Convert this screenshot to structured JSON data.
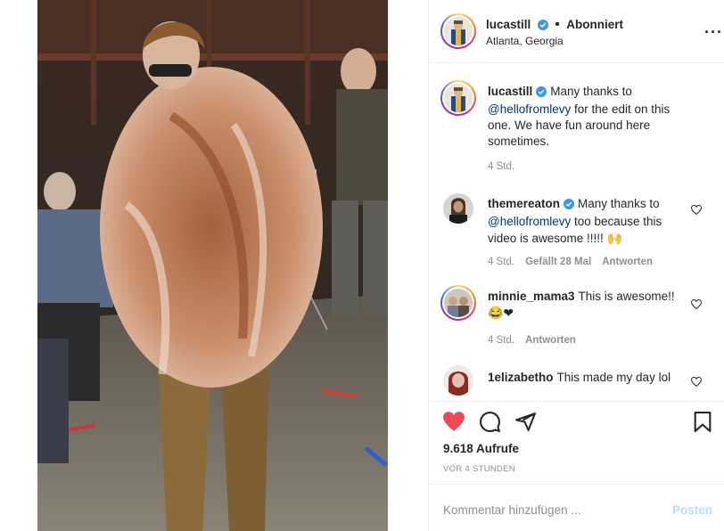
{
  "header": {
    "username": "lucastill",
    "follow_status": "Abonniert",
    "location": "Atlanta, Georgia",
    "more_icon": "ellipsis-icon"
  },
  "comments": [
    {
      "username": "lucastill",
      "text_before": "Many thanks to ",
      "mention": "@hellofromlevy",
      "text_after": " for the edit on this one. We have fun around here sometimes.",
      "emoji": "",
      "time": "4 Std.",
      "likes": "",
      "reply": "",
      "verified": true
    },
    {
      "username": "themereaton",
      "text_before": "Many thanks to ",
      "mention": "@hellofromlevy",
      "text_after": " too because this video is awesome !!!!! ",
      "emoji": "🙌",
      "time": "4 Std.",
      "likes": "Gefällt 28 Mal",
      "reply": "Antworten",
      "verified": true
    },
    {
      "username": "minnie_mama3",
      "text_before": "This is awesome!! ",
      "mention": "",
      "text_after": "",
      "emoji": "😂❤",
      "time": "4 Std.",
      "likes": "",
      "reply": "Antworten",
      "verified": false
    },
    {
      "username": "1elizabetho",
      "text_before": "This made my day lol",
      "mention": "",
      "text_after": "",
      "emoji": "",
      "time": "",
      "likes": "",
      "reply": "",
      "verified": false
    }
  ],
  "actions": {
    "like_icon": "heart-filled-icon",
    "comment_icon": "comment-bubble-icon",
    "share_icon": "paper-plane-icon",
    "save_icon": "bookmark-icon",
    "like_color": "#ed4956"
  },
  "stats": {
    "views": "9.618 Aufrufe",
    "posted": "VOR 4 STUNDEN"
  },
  "add_comment": {
    "placeholder": "Kommentar hinzufügen ...",
    "post_label": "Posten"
  },
  "colors": {
    "accent_link": "#00376b",
    "verified_blue": "#3897f0",
    "post_disabled": "#b2dffc",
    "muted": "#8e8e8e"
  }
}
